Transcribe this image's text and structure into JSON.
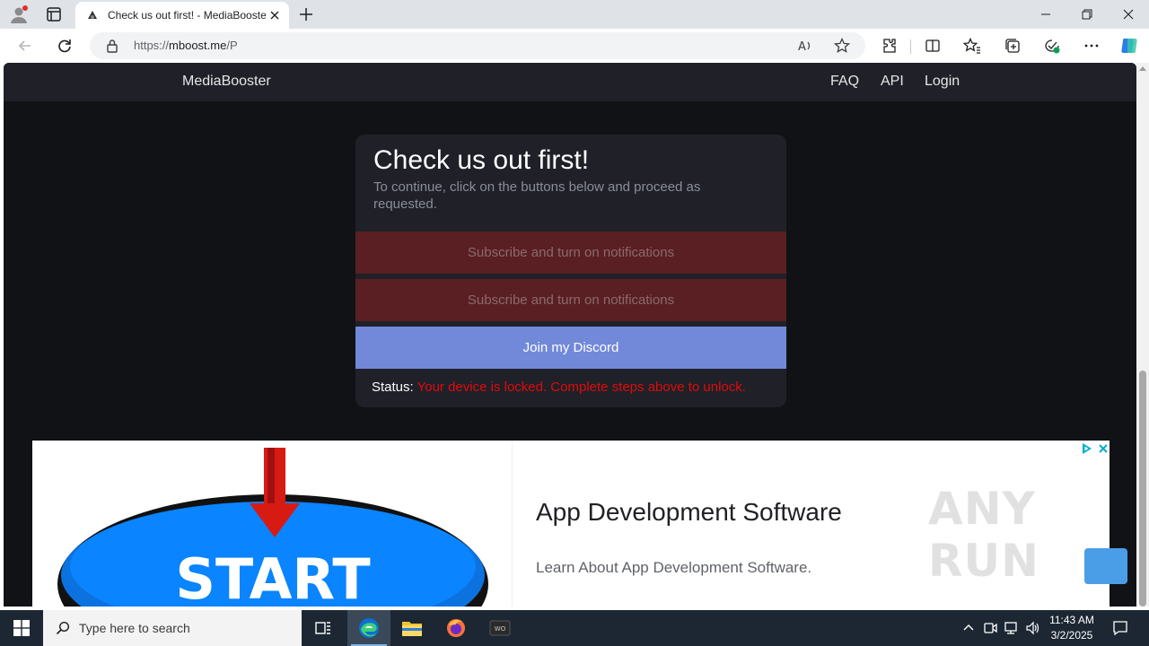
{
  "browser": {
    "tab": {
      "title": "Check us out first! - MediaBooster"
    },
    "address": {
      "scheme": "https://",
      "host": "mboost.me",
      "path": "/P"
    }
  },
  "site": {
    "brand": "MediaBooster",
    "nav": [
      {
        "label": "FAQ"
      },
      {
        "label": "API"
      },
      {
        "label": "Login"
      }
    ]
  },
  "card": {
    "title": "Check us out first!",
    "subtitle": "To continue, click on the buttons below and proceed as requested.",
    "steps": [
      {
        "label": "Subscribe and turn on notifications",
        "kind": "yt"
      },
      {
        "label": "Subscribe and turn on notifications",
        "kind": "yt"
      },
      {
        "label": "Join my Discord",
        "kind": "discord"
      }
    ],
    "status_label": "Status:",
    "status_value": "Your device is locked. Complete steps above to unlock."
  },
  "ad": {
    "image_text": "START",
    "headline": "App Development Software",
    "description": "Learn About App Development Software."
  },
  "watermark": "ANY RUN",
  "taskbar": {
    "search_placeholder": "Type here to search",
    "time": "11:43 AM",
    "date": "3/2/2025"
  },
  "colors": {
    "page_bg": "#111215",
    "card_bg": "#1f2028",
    "yt_button": "#5a1f22",
    "discord_button": "#7289da",
    "status_locked": "#e00b0b"
  }
}
